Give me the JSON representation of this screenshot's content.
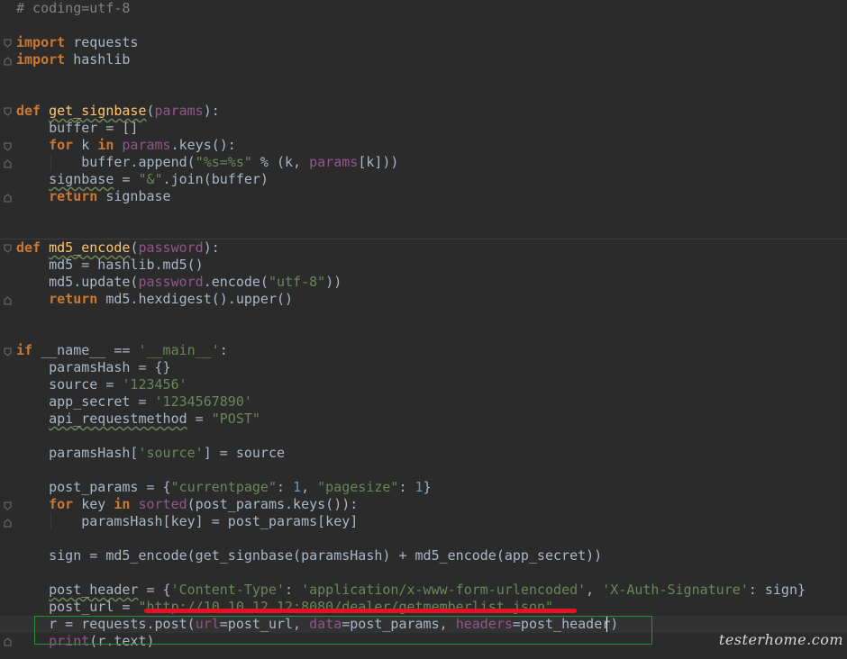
{
  "editor": {
    "language": "python",
    "theme_colors": {
      "background": "#2b2b2b",
      "keyword": "#cc7832",
      "function": "#ffc66d",
      "parameter": "#94558d",
      "string": "#6a8759",
      "number": "#6897bb",
      "comment": "#808080",
      "text": "#a9b7c6"
    },
    "lines": {
      "l1": "# coding=utf-8",
      "l3_kw": "import",
      "l3_rest": " requests",
      "l4_kw": "import",
      "l4_rest": " hashlib",
      "l7_kw": "def",
      "l7_fn": "get_signbase",
      "l7_p": "params",
      "l7_end": "):",
      "l8": "    buffer = []",
      "l9_kw": "for",
      "l9_a": " k ",
      "l9_kw2": "in",
      "l9_p": "params",
      "l9_b": ".keys():",
      "l10_a": "        buffer.append(",
      "l10_s": "\"%s=%s\"",
      "l10_b": " % (k, ",
      "l10_p": "params",
      "l10_c": "[k]))",
      "l11_a": "signbase",
      "l11_b": " = ",
      "l11_s": "\"&\"",
      "l11_c": ".join(buffer)",
      "l12_kw": "return",
      "l12_rest": " signbase",
      "l15_kw": "def",
      "l15_fn": "md5_encode",
      "l15_p": "password",
      "l15_end": "):",
      "l16": "    md5 = hashlib.md5()",
      "l17_a": "    md5.update(",
      "l17_p": "password",
      "l17_b": ".encode(",
      "l17_s": "\"utf-8\"",
      "l17_c": "))",
      "l18_kw": "return",
      "l18_rest": " md5.hexdigest().upper()",
      "l21_kw": "if",
      "l21_a": " __name__ == ",
      "l21_s": "'__main__'",
      "l21_b": ":",
      "l22": "    paramsHash = {}",
      "l23_a": "    source = ",
      "l23_s": "'123456'",
      "l24_a": "    app_secret = ",
      "l24_s": "'1234567890'",
      "l25_a": "api_requestmethod",
      "l25_b": " = ",
      "l25_s": "\"POST\"",
      "l27_a": "    paramsHash[",
      "l27_s": "'source'",
      "l27_b": "] = source",
      "l29_a": "    post_params = {",
      "l29_s1": "\"currentpage\"",
      "l29_b": ": ",
      "l29_n1": "1",
      "l29_c": ", ",
      "l29_s2": "\"pagesize\"",
      "l29_d": ": ",
      "l29_n2": "1",
      "l29_e": "}",
      "l30_kw": "for",
      "l30_a": " key ",
      "l30_kw2": "in",
      "l30_fn": "sorted",
      "l30_b": "(post_params.keys()):",
      "l31": "        paramsHash[key] = post_params[key]",
      "l33": "    sign = md5_encode(get_signbase(paramsHash) + md5_encode(app_secret))",
      "l35_a": "post_header",
      "l35_b": " = {",
      "l35_s1": "'Content-Type'",
      "l35_c": ": ",
      "l35_s2": "'application/x-www-form-urlencoded'",
      "l35_d": ", ",
      "l35_s3": "'X-Auth-Signature'",
      "l35_e": ": sign}",
      "l36_a": "    post_url = ",
      "l36_s": "\"http://10.10.12.12:8080/dealer/getmemberlist.json\"",
      "l37_a": "    r = requests.post(",
      "l37_p1": "url",
      "l37_b": "=post_url, ",
      "l37_p2": "data",
      "l37_c": "=post_params, ",
      "l37_p3": "headers",
      "l37_d": "=post_header)",
      "l38_a": "    ",
      "l38_fn": "print",
      "l38_b": "(r.text)"
    }
  },
  "watermark": "testerhome.com"
}
